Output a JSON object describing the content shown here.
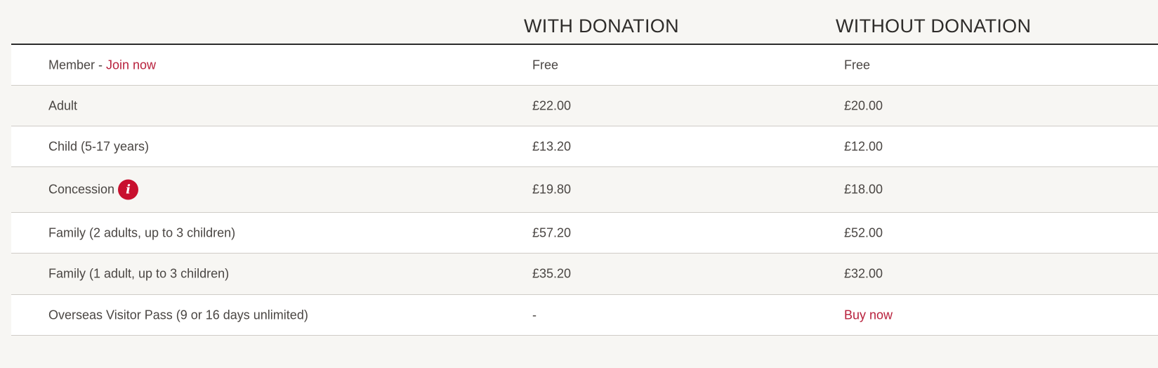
{
  "columns": {
    "with_donation": "WITH DONATION",
    "without_donation": "WITHOUT DONATION"
  },
  "rows": [
    {
      "label": "Member",
      "separator": " - ",
      "link_label": "Join now",
      "with": "Free",
      "without": "Free"
    },
    {
      "label": "Adult",
      "with": "£22.00",
      "without": "£20.00"
    },
    {
      "label": "Child (5-17 years)",
      "with": "£13.20",
      "without": "£12.00"
    },
    {
      "label": "Concession",
      "info_icon": "info-icon",
      "info_glyph": "i",
      "with": "£19.80",
      "without": "£18.00"
    },
    {
      "label": "Family (2 adults, up to 3 children)",
      "with": "£57.20",
      "without": "£52.00"
    },
    {
      "label": "Family (1 adult, up to 3 children)",
      "with": "£35.20",
      "without": "£32.00"
    },
    {
      "label": "Overseas Visitor Pass (9 or 16 days unlimited)",
      "with": "-",
      "without_link": "Buy now"
    }
  ],
  "colors": {
    "link": "#b8203c",
    "info_icon_bg": "#c8102e",
    "header_rule": "#2b2b2b",
    "row_alt": "#f7f6f3"
  }
}
